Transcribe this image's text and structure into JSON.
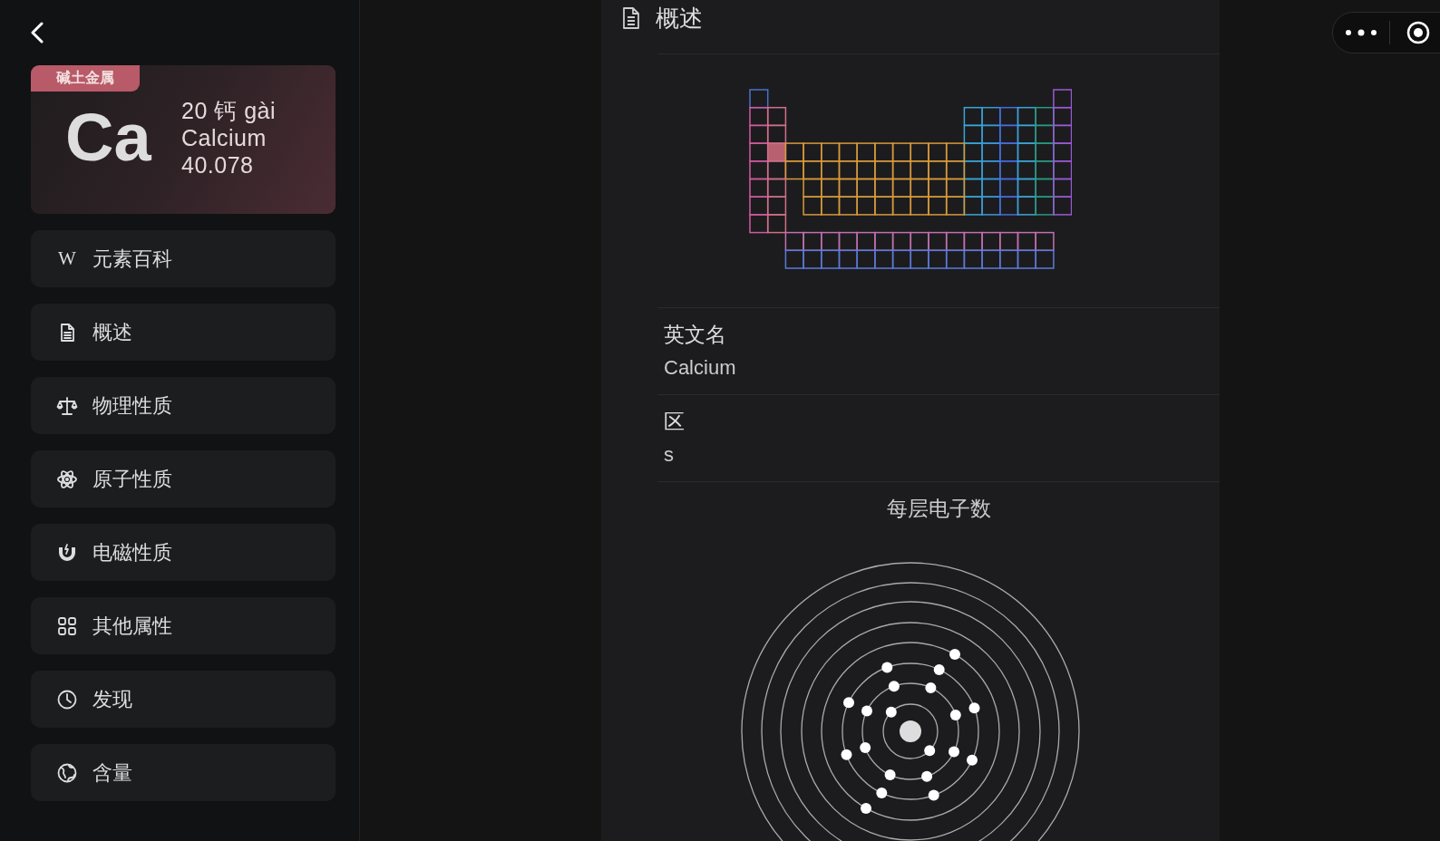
{
  "element_card": {
    "category": "碱土金属",
    "symbol": "Ca",
    "number_and_name": "20 钙 gài",
    "english_name": "Calcium",
    "atomic_mass": "40.078"
  },
  "sidebar": {
    "items": [
      {
        "label": "元素百科",
        "icon_text": "W"
      },
      {
        "label": "概述"
      },
      {
        "label": "物理性质"
      },
      {
        "label": "原子性质"
      },
      {
        "label": "电磁性质"
      },
      {
        "label": "其他属性"
      },
      {
        "label": "发现"
      },
      {
        "label": "含量"
      }
    ]
  },
  "section": {
    "title": "概述",
    "fields": [
      {
        "label": "英文名",
        "value": "Calcium"
      },
      {
        "label": "区",
        "value": "s"
      }
    ],
    "shell_diagram": {
      "title": "每层电子数"
    }
  }
}
